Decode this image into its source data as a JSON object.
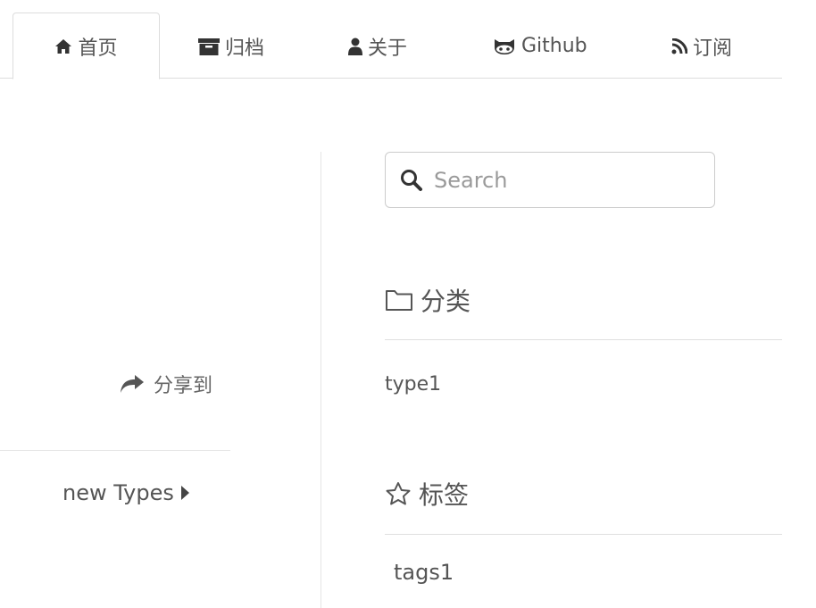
{
  "nav": {
    "tabs": [
      {
        "label": "首页",
        "icon": "home-icon",
        "active": true
      },
      {
        "label": "归档",
        "icon": "archive-icon",
        "active": false
      },
      {
        "label": "关于",
        "icon": "user-icon",
        "active": false
      },
      {
        "label": "Github",
        "icon": "github-icon",
        "active": false
      },
      {
        "label": "订阅",
        "icon": "rss-icon",
        "active": false
      }
    ]
  },
  "main": {
    "share_label": "分享到",
    "share_icon": "share-icon",
    "post_nav_label": "new Types",
    "post_nav_icon": "caret-right-icon"
  },
  "sidebar": {
    "search": {
      "placeholder": "Search",
      "value": "",
      "icon": "search-icon"
    },
    "categories": {
      "title": "分类",
      "icon": "folder-icon",
      "items": [
        "type1"
      ]
    },
    "tags": {
      "title": "标签",
      "icon": "star-icon",
      "items": [
        "tags1"
      ]
    }
  },
  "colors": {
    "text": "#555555",
    "border": "#dddddd",
    "placeholder": "#9a9a9a"
  }
}
